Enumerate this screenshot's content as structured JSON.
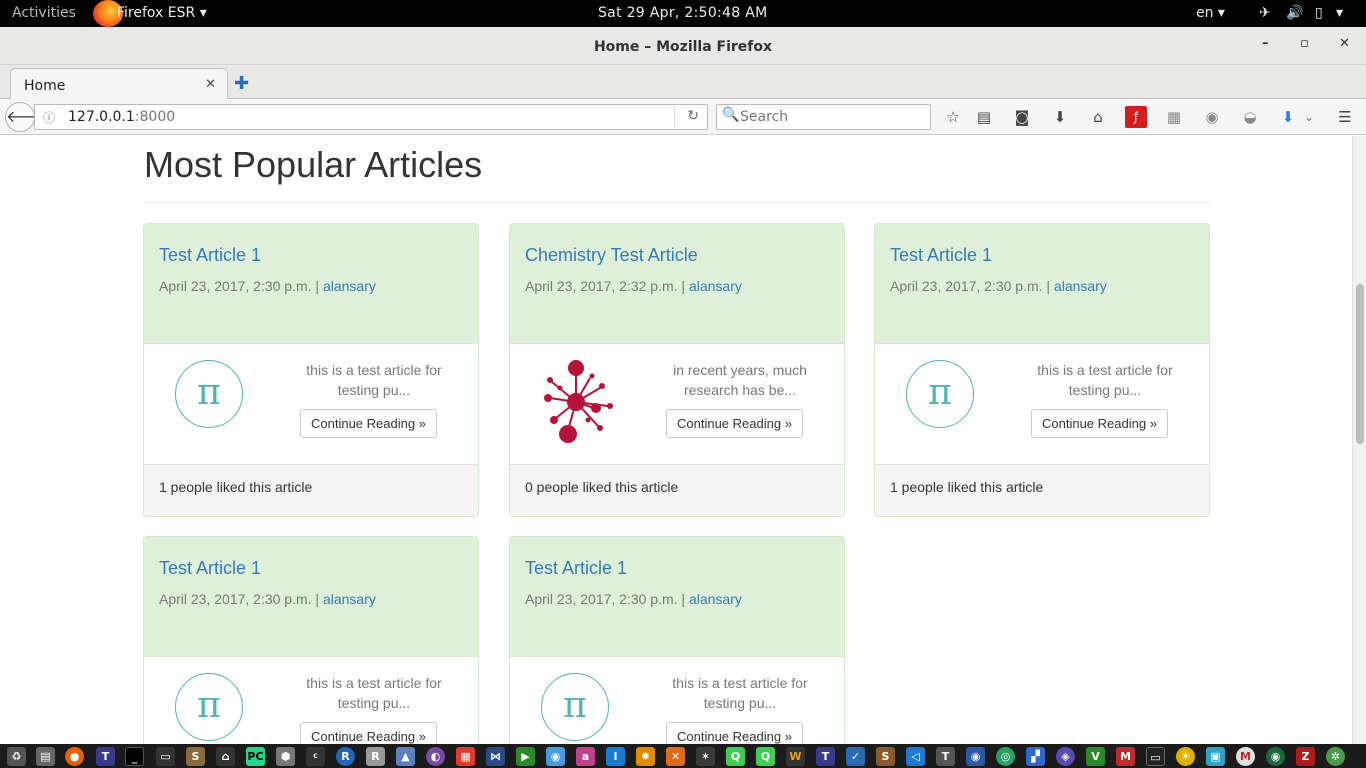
{
  "topbar": {
    "activities": "Activities",
    "app_name": "Firefox ESR ▾",
    "clock": "Sat 29 Apr,  2:50:48 AM",
    "lang": "en ▾"
  },
  "window": {
    "title": "Home – Mozilla Firefox",
    "minimize": "–",
    "maximize": "▫",
    "close": "✕"
  },
  "tab": {
    "label": "Home",
    "close": "✕",
    "new_tab": "✚"
  },
  "navbar": {
    "url_host": "127.0.0.1",
    "url_port": ":8000",
    "search_placeholder": "Search"
  },
  "page": {
    "heading": "Most Popular Articles",
    "articles": [
      {
        "title": "Test Article 1",
        "date": "April 23, 2017, 2:30 p.m. | ",
        "author": "alansary",
        "excerpt": "this is a test article for testing pu...",
        "button": "Continue Reading »",
        "likes": "1 people liked this article",
        "image": "pi"
      },
      {
        "title": "Chemistry Test Article",
        "date": "April 23, 2017, 2:32 p.m. | ",
        "author": "alansary",
        "excerpt": "in recent years, much research has be...",
        "button": "Continue Reading »",
        "likes": "0 people liked this article",
        "image": "molecule"
      },
      {
        "title": "Test Article 1",
        "date": "April 23, 2017, 2:30 p.m. | ",
        "author": "alansary",
        "excerpt": "this is a test article for testing pu...",
        "button": "Continue Reading »",
        "likes": "1 people liked this article",
        "image": "pi"
      },
      {
        "title": "Test Article 1",
        "date": "April 23, 2017, 2:30 p.m. | ",
        "author": "alansary",
        "excerpt": "this is a test article for testing pu...",
        "button": "Continue Reading »",
        "likes": "",
        "image": "pi"
      },
      {
        "title": "Test Article 1",
        "date": "April 23, 2017, 2:30 p.m. | ",
        "author": "alansary",
        "excerpt": "this is a test article for testing pu...",
        "button": "Continue Reading »",
        "likes": "",
        "image": "pi"
      }
    ],
    "pi_symbol": "π"
  },
  "colors": {
    "card_header": "#dff0d8",
    "link": "#337ab7",
    "pi_teal": "#4eb3b3",
    "molecule_red": "#b5123a"
  }
}
